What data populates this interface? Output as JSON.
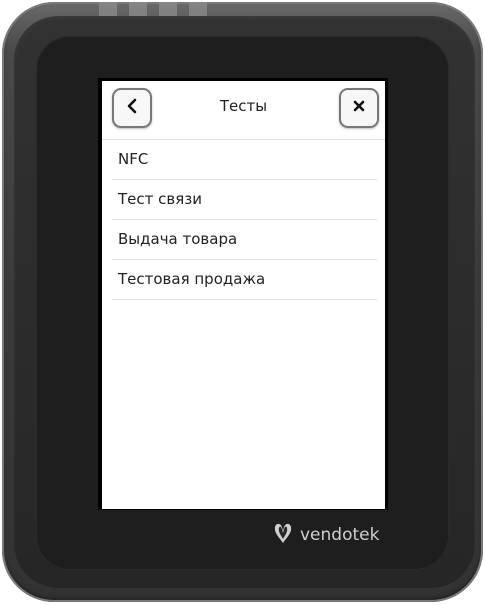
{
  "header": {
    "title": "Тесты",
    "back_label": "<",
    "close_label": "✕"
  },
  "menu": {
    "items": [
      {
        "label": "NFC"
      },
      {
        "label": "Тест связи"
      },
      {
        "label": "Выдача товара"
      },
      {
        "label": "Тестовая продажа"
      }
    ]
  },
  "device": {
    "brand": "vendotek",
    "logo_icon": "vendotek-logo-icon"
  },
  "colors": {
    "bezel": "#262626",
    "screen_bg": "#ffffff",
    "button_border": "#777777",
    "brand_text": "#cfcfcf"
  }
}
